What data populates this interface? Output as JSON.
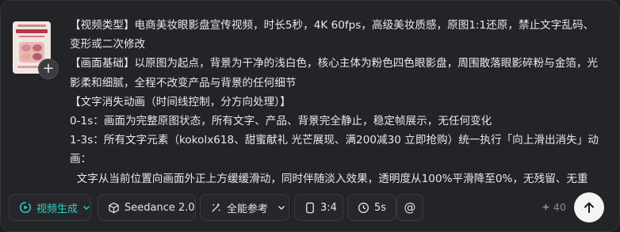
{
  "prompt": {
    "paragraphs": [
      "【视频类型】电商美妆眼影盘宣传视频，时长5秒，4K 60fps，高级美妆质感，原图1:1还原，禁止文字乱码、变形或二次修改",
      "【画面基础】以原图为起点，背景为干净的浅白色，核心主体为粉色四色眼影盘，周围散落眼影碎粉与金箔，光影柔和细腻，全程不改变产品与背景的任何细节",
      "【文字消失动画（时间线控制，分方向处理）】",
      "0-1s：画面为完整原图状态，所有文字、产品、背景完全静止，稳定帧展示，无任何变化",
      "1-3s：所有文字元素（kokolx618、甜蜜献礼 光芒展现、满200减30 立即抢购）统一执行「向上滑出消失」动画：",
      "  文字从当前位置向画面外正上方缓缓滑动，同时伴随淡入效果，透明度从100%平滑降至0%，无残留、无重"
    ]
  },
  "toolbar": {
    "mode_label": "视频生成",
    "model_label": "Seedance 2.0",
    "reference_label": "全能参考",
    "ratio_label": "3:4",
    "duration_label": "5s",
    "mention_label": "@",
    "credits": "40",
    "accent_color": "#2fd0c5"
  }
}
